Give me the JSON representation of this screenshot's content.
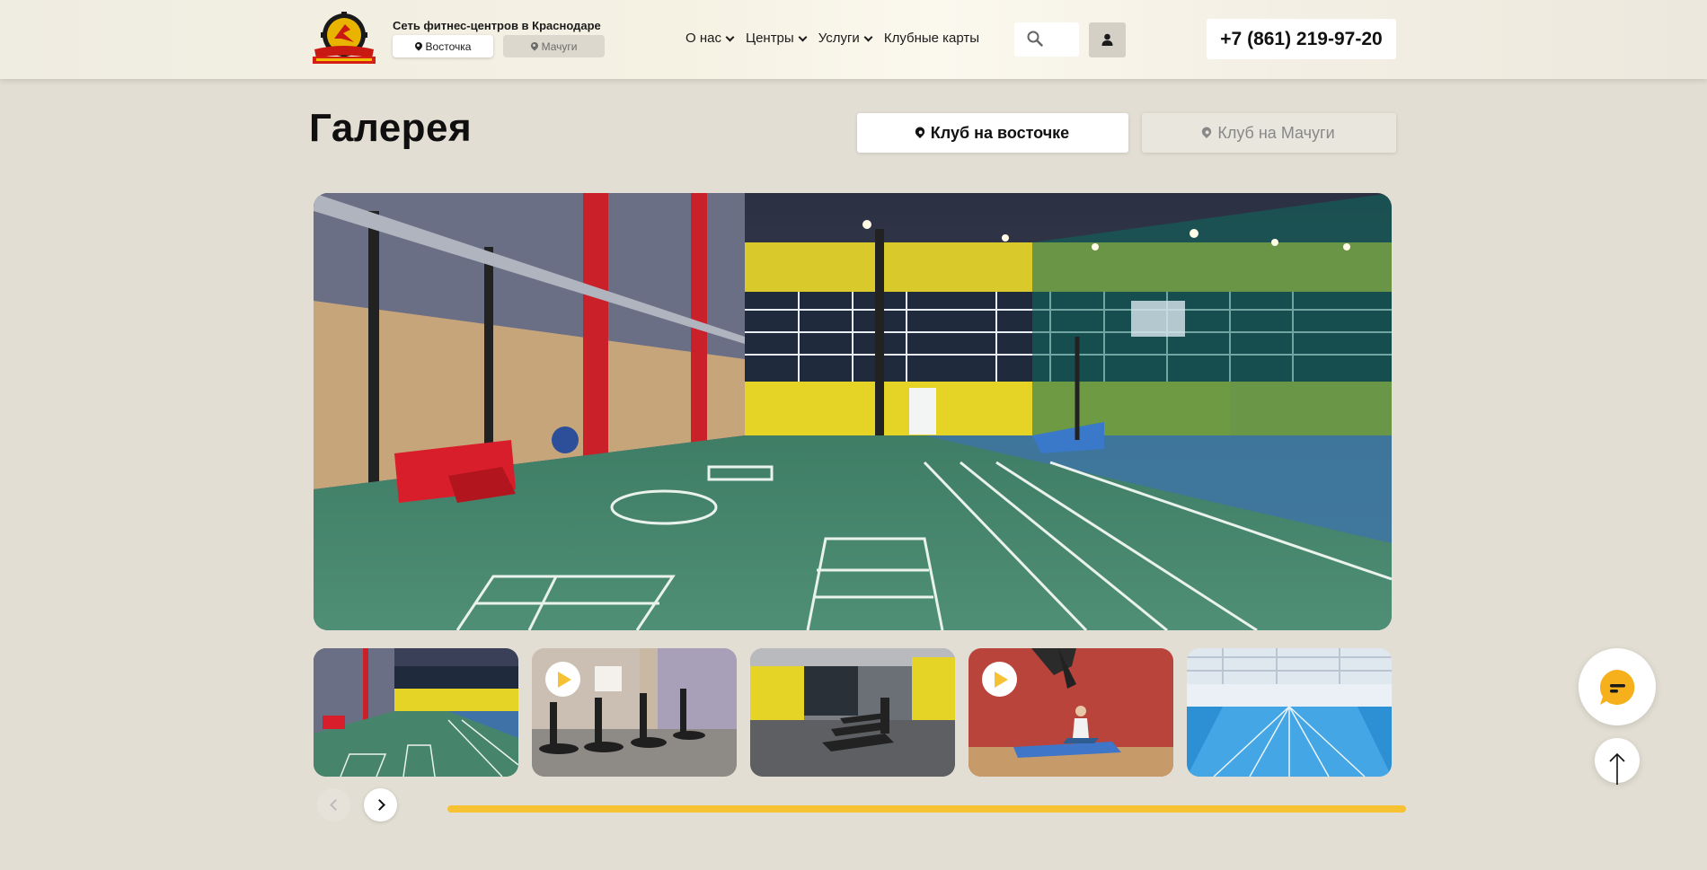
{
  "header": {
    "tagline": "Сеть фитнес-центров в Краснодаре",
    "clubs": [
      {
        "label": "Восточка",
        "active": true
      },
      {
        "label": "Мачуги",
        "active": false
      }
    ],
    "nav": [
      {
        "label": "О нас",
        "dropdown": true
      },
      {
        "label": "Центры",
        "dropdown": true
      },
      {
        "label": "Услуги",
        "dropdown": true
      },
      {
        "label": "Клубные карты",
        "dropdown": false
      }
    ],
    "search_icon": "search-icon",
    "user_icon": "user-icon",
    "phone": "+7 (861) 219-97-20"
  },
  "gallery": {
    "title": "Галерея",
    "tabs": [
      {
        "label": "Клуб на восточке",
        "active": true
      },
      {
        "label": "Клуб на Мачуги",
        "active": false
      }
    ],
    "main_image": "sports-hall-photo",
    "thumbnails": [
      {
        "image": "sports-hall-thumb",
        "video": false
      },
      {
        "image": "cycling-studio-thumb",
        "video": true
      },
      {
        "image": "treadmills-thumb",
        "video": false
      },
      {
        "image": "yoga-mat-thumb",
        "video": true
      },
      {
        "image": "swimming-pool-thumb",
        "video": false
      }
    ],
    "prev_icon": "chevron-left-icon",
    "next_icon": "chevron-right-icon"
  },
  "floating": {
    "chat_icon": "chat-icon",
    "scroll_top_icon": "arrow-up-icon"
  },
  "colors": {
    "accent": "#f6c234",
    "background": "#e2ded3",
    "header_bg": "#f5f1e3"
  }
}
